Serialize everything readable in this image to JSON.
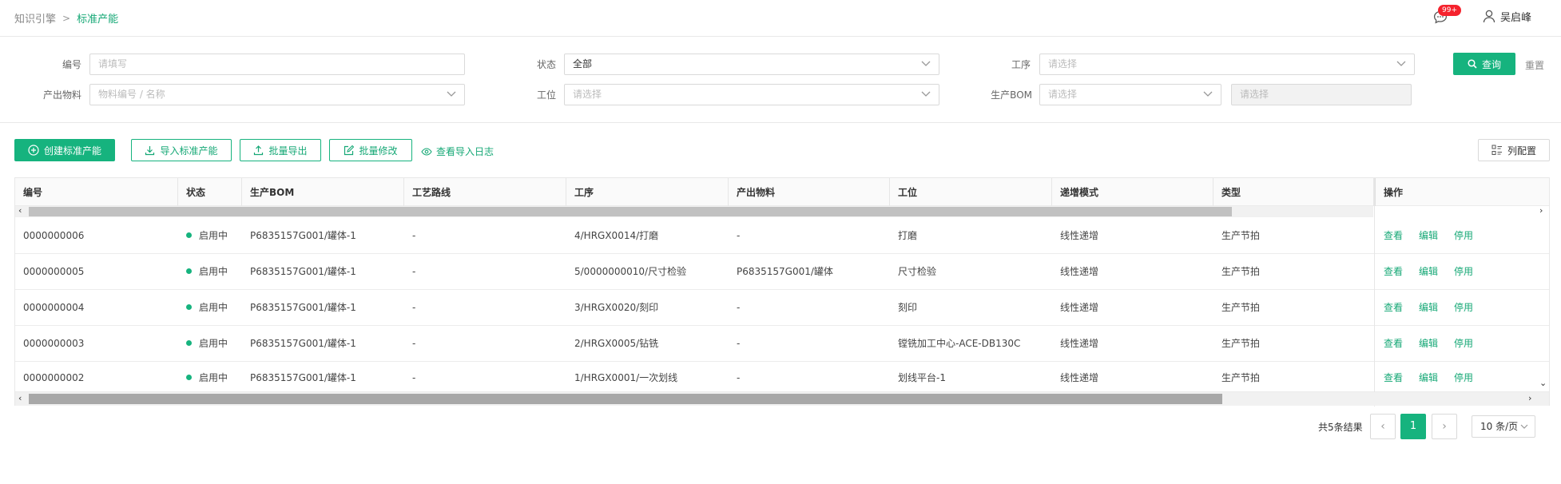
{
  "breadcrumb": {
    "parent": "知识引擎",
    "separator": ">",
    "current": "标准产能"
  },
  "header": {
    "badge": "99+",
    "user_name": "吴启峰"
  },
  "filters": {
    "code_label": "编号",
    "code_placeholder": "请填写",
    "status_label": "状态",
    "status_value": "全部",
    "process_label": "工序",
    "process_placeholder": "请选择",
    "material_label": "产出物料",
    "material_placeholder": "物料编号 / 名称",
    "station_label": "工位",
    "station_placeholder": "请选择",
    "bom_label": "生产BOM",
    "bom_placeholder": "请选择",
    "bom_version_placeholder": "请选择",
    "query_label": "查询",
    "reset_label": "重置"
  },
  "toolbar": {
    "create_label": "创建标准产能",
    "import_label": "导入标准产能",
    "export_label": "批量导出",
    "batch_edit_label": "批量修改",
    "import_log_label": "查看导入日志",
    "column_config_label": "列配置"
  },
  "table": {
    "columns": [
      "编号",
      "状态",
      "生产BOM",
      "工艺路线",
      "工序",
      "产出物料",
      "工位",
      "递增模式",
      "类型",
      "操作"
    ],
    "rows": [
      {
        "code": "0000000006",
        "status": "启用中",
        "bom": "P6835157G001/罐体-1",
        "route": "-",
        "process": "4/HRGX0014/打磨",
        "material": "-",
        "station": "打磨",
        "mode": "线性递增",
        "type": "生产节拍"
      },
      {
        "code": "0000000005",
        "status": "启用中",
        "bom": "P6835157G001/罐体-1",
        "route": "-",
        "process": "5/0000000010/尺寸检验",
        "material": "P6835157G001/罐体",
        "station": "尺寸检验",
        "mode": "线性递增",
        "type": "生产节拍"
      },
      {
        "code": "0000000004",
        "status": "启用中",
        "bom": "P6835157G001/罐体-1",
        "route": "-",
        "process": "3/HRGX0020/刻印",
        "material": "-",
        "station": "刻印",
        "mode": "线性递增",
        "type": "生产节拍"
      },
      {
        "code": "0000000003",
        "status": "启用中",
        "bom": "P6835157G001/罐体-1",
        "route": "-",
        "process": "2/HRGX0005/钻铣",
        "material": "-",
        "station": "镗铣加工中心-ACE-DB130C",
        "mode": "线性递增",
        "type": "生产节拍"
      },
      {
        "code": "0000000002",
        "status": "启用中",
        "bom": "P6835157G001/罐体-1",
        "route": "-",
        "process": "1/HRGX0001/一次划线",
        "material": "-",
        "station": "划线平台-1",
        "mode": "线性递增",
        "type": "生产节拍"
      }
    ],
    "actions": {
      "view": "查看",
      "edit": "编辑",
      "disable": "停用"
    }
  },
  "pagination": {
    "total_text": "共5条结果",
    "current_page": "1",
    "page_size": "10 条/页"
  },
  "colors": {
    "accent": "#16b37e",
    "badge": "#f5222d"
  },
  "icons": [
    "message-icon",
    "user-icon",
    "chevron-down-icon",
    "search-icon",
    "plus-circle-icon",
    "download-icon",
    "upload-icon",
    "edit-icon",
    "eye-icon",
    "column-config-icon"
  ]
}
